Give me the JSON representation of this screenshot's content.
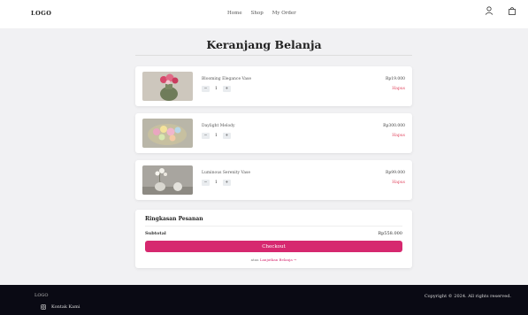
{
  "nav": {
    "logo": "LOGO",
    "links": [
      "Home",
      "Shop",
      "My Order"
    ]
  },
  "page_title": "Keranjang Belanja",
  "cart": [
    {
      "name": "Blooming Elegance Vase",
      "qty": "1",
      "price": "Rp19.000",
      "remove": "Hapus",
      "colors": {
        "bg": "#cdc7bd",
        "vase": "#6f7c5a",
        "flower": "#d6486b"
      }
    },
    {
      "name": "Daylight Melody",
      "qty": "1",
      "price": "Rp300.000",
      "remove": "Hapus",
      "colors": {
        "bg": "#b9b6a8",
        "vase": "#c7c0a0",
        "flower": "#e9a6c0"
      }
    },
    {
      "name": "Luminous Serenity Vase",
      "qty": "1",
      "price": "Rp99.000",
      "remove": "Hapus",
      "colors": {
        "bg": "#a8a59f",
        "vase": "#d9d7d0",
        "flower": "#f2f0ea"
      }
    }
  ],
  "qty_minus": "−",
  "qty_plus": "+",
  "summary": {
    "title": "Ringkasan Pesanan",
    "subtotal_label": "Subtotal",
    "subtotal_value": "Rp558.000",
    "checkout": "Checkout",
    "continue_prefix": "atau ",
    "continue_link": "Lanjutkan Belanja →"
  },
  "footer": {
    "logo": "LOGO",
    "contact": "Kontak Kami",
    "copyright": "Copyright © 2024. All rights reserved."
  },
  "accent_color": "#d6286f",
  "icons": [
    "user-icon",
    "bag-icon",
    "instagram-icon"
  ]
}
